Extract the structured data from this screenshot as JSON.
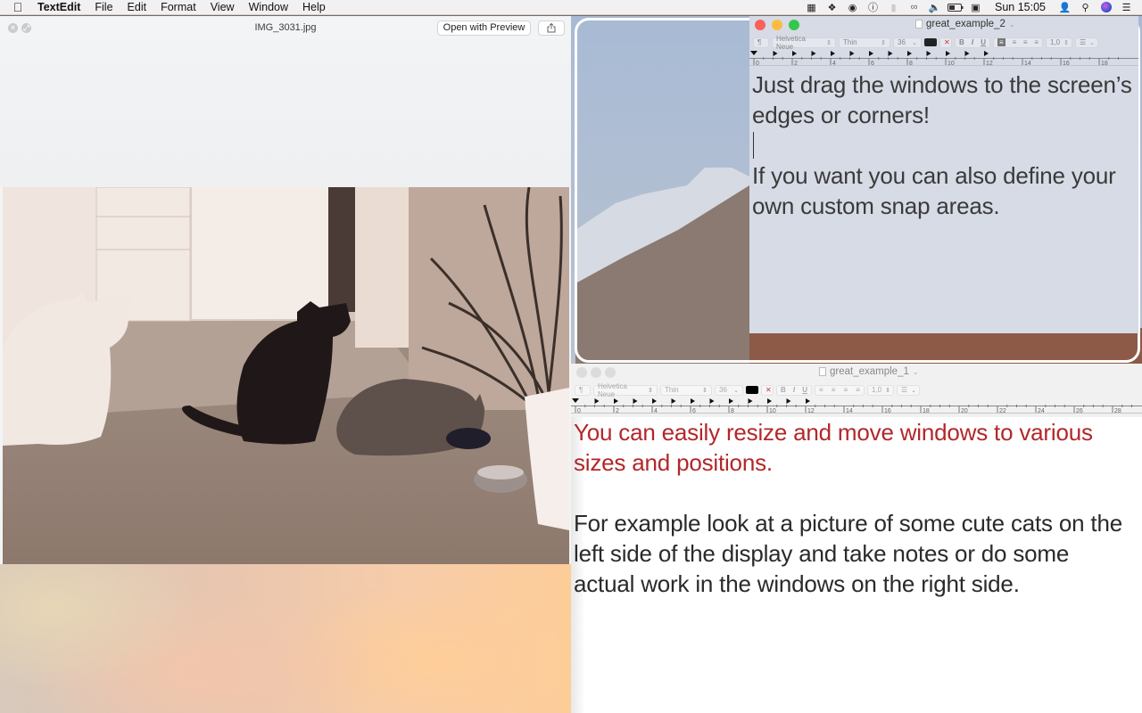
{
  "menubar": {
    "apple_icon": "apple-logo",
    "app_name": "TextEdit",
    "menus": [
      "File",
      "Edit",
      "Format",
      "View",
      "Window",
      "Help"
    ],
    "status_icons": [
      "window-manager-icon",
      "dropbox-icon",
      "creative-cloud-icon",
      "1password-icon",
      "battery-meter-icon",
      "wifi-icon",
      "volume-icon",
      "battery-icon",
      "display-icon"
    ],
    "clock": "Sun 15:05",
    "right_icons": [
      "user-icon",
      "spotlight-search-icon",
      "siri-icon",
      "notification-center-icon"
    ]
  },
  "quicklook": {
    "title": "IMG_3031.jpg",
    "open_with_label": "Open with Preview",
    "share_icon": "share-icon",
    "close_icon": "close-icon",
    "fullscreen_icon": "fullscreen-icon"
  },
  "textedit_top": {
    "title": "great_example_2",
    "toolbar": {
      "paragraph": "¶",
      "font_family": "Helvetica Neue",
      "font_style": "Thin",
      "font_size": "36",
      "line_spacing": "1,0"
    },
    "ruler_labels": [
      "0",
      "2",
      "4",
      "6",
      "8",
      "10",
      "12",
      "14",
      "16",
      "18"
    ],
    "paragraph1": "Just drag the windows to the screen’s edges or corners!",
    "paragraph2": "If you want you can also define your own custom snap areas."
  },
  "textedit_bottom": {
    "title": "great_example_1",
    "toolbar": {
      "paragraph": "¶",
      "font_family": "Helvetica Neue",
      "font_style": "Thin",
      "font_size": "36",
      "line_spacing": "1,0"
    },
    "ruler_labels": [
      "0",
      "2",
      "4",
      "6",
      "8",
      "10",
      "12",
      "14",
      "16",
      "18",
      "20",
      "22",
      "24",
      "26",
      "28"
    ],
    "paragraph1": "You can easily resize and move windows to various sizes and positions.",
    "paragraph2": "For example look at a picture of some cute cats on the left side of the display and take notes or do some actual work in the windows on the right side."
  },
  "colors": {
    "traffic_close": "#fc605b",
    "traffic_min": "#fdbc40",
    "traffic_max": "#34c84a",
    "red_text": "#b3272a",
    "selected_textedit_bg": "#d6dbe6"
  }
}
